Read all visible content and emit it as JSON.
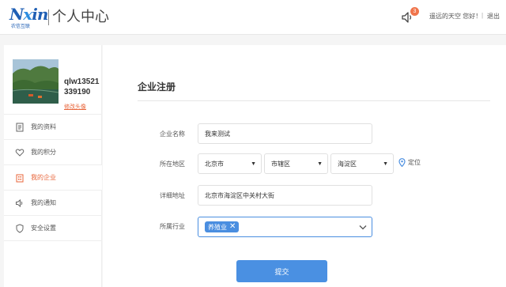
{
  "header": {
    "logo_text": "Nxin",
    "logo_sub": "农信互联",
    "title": "个人中心",
    "notification_count": "3",
    "greeting": "遥远的天空 您好！",
    "separator": "|",
    "logout_label": "退出"
  },
  "profile": {
    "username": "qlw13521339190",
    "change_avatar_label": "修改头像"
  },
  "sidebar": {
    "items": [
      {
        "label": "我的资料",
        "icon": "document-icon"
      },
      {
        "label": "我的积分",
        "icon": "heart-icon"
      },
      {
        "label": "我的企业",
        "icon": "enterprise-icon"
      },
      {
        "label": "我的通知",
        "icon": "speaker-icon"
      },
      {
        "label": "安全设置",
        "icon": "shield-icon"
      }
    ],
    "active_index": 2
  },
  "form": {
    "title": "企业注册",
    "company_name_label": "企业名称",
    "company_name_value": "我来测试",
    "region_label": "所在地区",
    "province": "北京市",
    "city": "市辖区",
    "district": "海淀区",
    "locate_label": "定位",
    "address_label": "详细地址",
    "address_value": "北京市海淀区中关村大街",
    "industry_label": "所属行业",
    "industry_tags": [
      "养殖业"
    ],
    "submit_label": "提交"
  },
  "colors": {
    "accent": "#e8653a",
    "primary": "#4a90e2",
    "badge": "#f0744b"
  }
}
